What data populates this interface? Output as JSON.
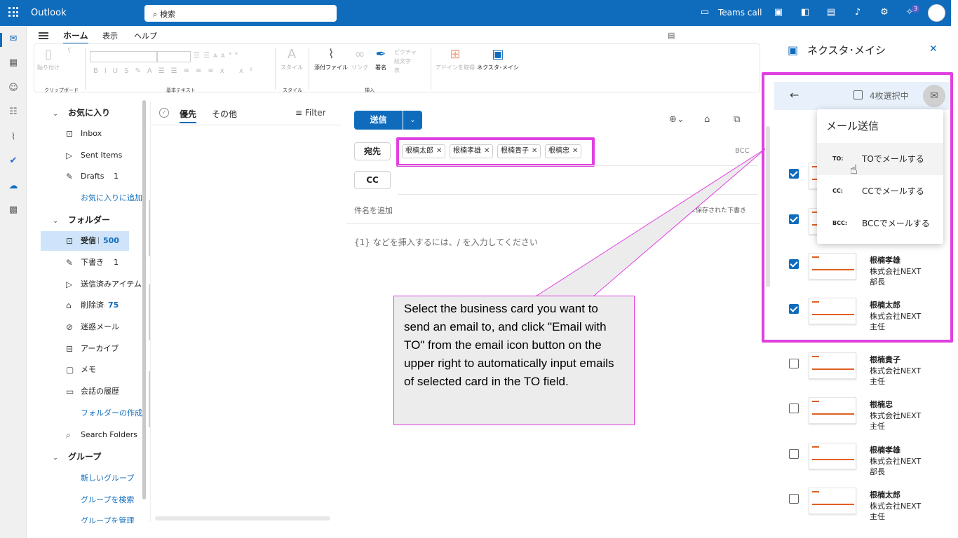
{
  "app": {
    "name": "Outlook",
    "search_placeholder": "検索",
    "teams_call": "Teams call",
    "notification_count": "3"
  },
  "menu_tabs": [
    "ホーム",
    "表示",
    "ヘルプ"
  ],
  "ribbon": {
    "groups": [
      "クリップボード",
      "基本テキスト",
      "スタイル",
      "挿入"
    ],
    "paste": "貼り付け",
    "style": "スタイル",
    "attach": "添付ファイル",
    "link": "リンク",
    "signature": "署名",
    "picture": "ピクチャ",
    "emoji": "絵文字",
    "table": "表",
    "addins": "アドインを取得",
    "nexsta": "ネクスタ･メイシ"
  },
  "nav": {
    "favorites": "お気に入り",
    "fav_items": [
      {
        "label": "Inbox",
        "count": ""
      },
      {
        "label": "Sent Items",
        "count": ""
      },
      {
        "label": "Drafts",
        "count": "1"
      }
    ],
    "fav_add": "お気に入りに追加",
    "folders": "フォルダー",
    "folder_items": [
      {
        "label": "受信トレイ",
        "count": "500"
      },
      {
        "label": "下書き",
        "count": "1"
      },
      {
        "label": "送信済みアイテム",
        "count": ""
      },
      {
        "label": "削除済みアイテム",
        "count": "75"
      },
      {
        "label": "迷惑メール",
        "count": ""
      },
      {
        "label": "アーカイブ",
        "count": ""
      },
      {
        "label": "メモ",
        "count": ""
      },
      {
        "label": "会話の履歴",
        "count": ""
      }
    ],
    "new_folder": "フォルダーの作成",
    "search_folders": "Search Folders",
    "groups": "グループ",
    "group_new": "新しいグループ",
    "group_find": "グループを検索",
    "group_more": "グループを管理"
  },
  "list": {
    "tab_focused": "優先",
    "tab_other": "その他",
    "filter": "Filter"
  },
  "compose": {
    "send": "送信",
    "to_label": "宛先",
    "cc_label": "CC",
    "bcc": "BCC",
    "recipients": [
      "根楠太郎",
      "根楠孝雄",
      "根楠貴子",
      "根楠忠"
    ],
    "subject_placeholder": "件名を追加",
    "draft_saved": "に保存された下書き",
    "body_placeholder": "{1} などを挿入するには、/ を入力してください"
  },
  "panel": {
    "title": "ネクスタ･メイシ",
    "selected": "4枚選択中",
    "menu_title": "メール送信",
    "menu_items": [
      {
        "key": "TO:",
        "label": "TOでメールする"
      },
      {
        "key": "CC:",
        "label": "CCでメールする"
      },
      {
        "key": "BCC:",
        "label": "BCCでメールする"
      }
    ],
    "cards": [
      {
        "name": "",
        "company": "",
        "title": "",
        "checked": true
      },
      {
        "name": "",
        "company": "",
        "title": "",
        "checked": true
      },
      {
        "name": "根楠孝雄",
        "company": "株式会社NEXT",
        "title": "部長",
        "checked": true
      },
      {
        "name": "根楠太郎",
        "company": "株式会社NEXT",
        "title": "主任",
        "checked": true
      },
      {
        "name": "根楠貴子",
        "company": "株式会社NEXT",
        "title": "主任",
        "checked": false
      },
      {
        "name": "根楠忠",
        "company": "株式会社NEXT",
        "title": "主任",
        "checked": false
      },
      {
        "name": "根楠孝雄",
        "company": "株式会社NEXT",
        "title": "部長",
        "checked": false
      },
      {
        "name": "根楠太郎",
        "company": "株式会社NEXT",
        "title": "主任",
        "checked": false
      }
    ]
  },
  "callout": "Select the business card you want to send an email to, and click \"Email with TO\" from the email icon button on the upper right to automatically input emails of selected card in the TO field.",
  "colors": {
    "brand": "#0f6cbd",
    "highlight": "#e040e0"
  }
}
